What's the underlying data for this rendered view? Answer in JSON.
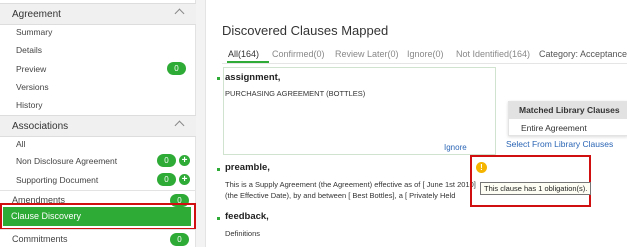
{
  "sidebar": {
    "agreement": {
      "title": "Agreement",
      "items": [
        {
          "label": "Summary"
        },
        {
          "label": "Details"
        },
        {
          "label": "Preview",
          "badge": "0"
        },
        {
          "label": "Versions"
        },
        {
          "label": "History"
        }
      ]
    },
    "associations": {
      "title": "Associations",
      "items": [
        {
          "label": "All"
        },
        {
          "label": "Non Disclosure Agreement",
          "badge": "0"
        },
        {
          "label": "Supporting Document",
          "badge": "0"
        }
      ]
    },
    "amendments": {
      "label": "Amendments",
      "badge": "0"
    },
    "clause_discovery": {
      "label": "Clause Discovery"
    },
    "commitments": {
      "label": "Commitments",
      "badge": "0"
    }
  },
  "main": {
    "title": "Discovered Clauses Mapped",
    "tabs": [
      {
        "label": "All(164)"
      },
      {
        "label": "Confirmed(0)"
      },
      {
        "label": "Review Later(0)"
      },
      {
        "label": "Ignore(0)"
      },
      {
        "label": "Not Identified(164)"
      },
      {
        "label": "Category: Acceptance"
      }
    ],
    "clauses": [
      {
        "title": "assignment,",
        "lines": [
          "PURCHASING AGREEMENT (BOTTLES)"
        ]
      },
      {
        "title": "preamble,",
        "lines": [
          "This is a Supply Agreement (the Agreement) effective as of [ June 1st 2010]",
          "(the Effective Date), by and between [ Best Bottles], a [ Privately Held"
        ]
      },
      {
        "title": "feedback,",
        "lines": [
          "Definitions"
        ]
      }
    ],
    "ignore_link": "Ignore",
    "menu": {
      "header": "Matched Library Clauses",
      "item": "Entire Agreement"
    },
    "select_library": "Select From Library Clauses",
    "warning_icon": "!",
    "tooltip": "This clause has 1 obligation(s)."
  },
  "colors": {
    "accent": "#2eaa36",
    "highlight": "#d01010",
    "link": "#2a65b5",
    "warning": "#f5b400"
  }
}
